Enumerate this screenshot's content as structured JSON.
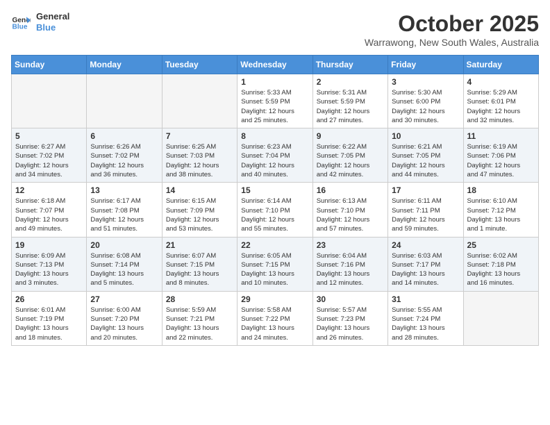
{
  "header": {
    "logo_line1": "General",
    "logo_line2": "Blue",
    "month": "October 2025",
    "location": "Warrawong, New South Wales, Australia"
  },
  "days_of_week": [
    "Sunday",
    "Monday",
    "Tuesday",
    "Wednesday",
    "Thursday",
    "Friday",
    "Saturday"
  ],
  "weeks": [
    [
      {
        "num": "",
        "info": ""
      },
      {
        "num": "",
        "info": ""
      },
      {
        "num": "",
        "info": ""
      },
      {
        "num": "1",
        "info": "Sunrise: 5:33 AM\nSunset: 5:59 PM\nDaylight: 12 hours\nand 25 minutes."
      },
      {
        "num": "2",
        "info": "Sunrise: 5:31 AM\nSunset: 5:59 PM\nDaylight: 12 hours\nand 27 minutes."
      },
      {
        "num": "3",
        "info": "Sunrise: 5:30 AM\nSunset: 6:00 PM\nDaylight: 12 hours\nand 30 minutes."
      },
      {
        "num": "4",
        "info": "Sunrise: 5:29 AM\nSunset: 6:01 PM\nDaylight: 12 hours\nand 32 minutes."
      }
    ],
    [
      {
        "num": "5",
        "info": "Sunrise: 6:27 AM\nSunset: 7:02 PM\nDaylight: 12 hours\nand 34 minutes."
      },
      {
        "num": "6",
        "info": "Sunrise: 6:26 AM\nSunset: 7:02 PM\nDaylight: 12 hours\nand 36 minutes."
      },
      {
        "num": "7",
        "info": "Sunrise: 6:25 AM\nSunset: 7:03 PM\nDaylight: 12 hours\nand 38 minutes."
      },
      {
        "num": "8",
        "info": "Sunrise: 6:23 AM\nSunset: 7:04 PM\nDaylight: 12 hours\nand 40 minutes."
      },
      {
        "num": "9",
        "info": "Sunrise: 6:22 AM\nSunset: 7:05 PM\nDaylight: 12 hours\nand 42 minutes."
      },
      {
        "num": "10",
        "info": "Sunrise: 6:21 AM\nSunset: 7:05 PM\nDaylight: 12 hours\nand 44 minutes."
      },
      {
        "num": "11",
        "info": "Sunrise: 6:19 AM\nSunset: 7:06 PM\nDaylight: 12 hours\nand 47 minutes."
      }
    ],
    [
      {
        "num": "12",
        "info": "Sunrise: 6:18 AM\nSunset: 7:07 PM\nDaylight: 12 hours\nand 49 minutes."
      },
      {
        "num": "13",
        "info": "Sunrise: 6:17 AM\nSunset: 7:08 PM\nDaylight: 12 hours\nand 51 minutes."
      },
      {
        "num": "14",
        "info": "Sunrise: 6:15 AM\nSunset: 7:09 PM\nDaylight: 12 hours\nand 53 minutes."
      },
      {
        "num": "15",
        "info": "Sunrise: 6:14 AM\nSunset: 7:10 PM\nDaylight: 12 hours\nand 55 minutes."
      },
      {
        "num": "16",
        "info": "Sunrise: 6:13 AM\nSunset: 7:10 PM\nDaylight: 12 hours\nand 57 minutes."
      },
      {
        "num": "17",
        "info": "Sunrise: 6:11 AM\nSunset: 7:11 PM\nDaylight: 12 hours\nand 59 minutes."
      },
      {
        "num": "18",
        "info": "Sunrise: 6:10 AM\nSunset: 7:12 PM\nDaylight: 13 hours\nand 1 minute."
      }
    ],
    [
      {
        "num": "19",
        "info": "Sunrise: 6:09 AM\nSunset: 7:13 PM\nDaylight: 13 hours\nand 3 minutes."
      },
      {
        "num": "20",
        "info": "Sunrise: 6:08 AM\nSunset: 7:14 PM\nDaylight: 13 hours\nand 5 minutes."
      },
      {
        "num": "21",
        "info": "Sunrise: 6:07 AM\nSunset: 7:15 PM\nDaylight: 13 hours\nand 8 minutes."
      },
      {
        "num": "22",
        "info": "Sunrise: 6:05 AM\nSunset: 7:15 PM\nDaylight: 13 hours\nand 10 minutes."
      },
      {
        "num": "23",
        "info": "Sunrise: 6:04 AM\nSunset: 7:16 PM\nDaylight: 13 hours\nand 12 minutes."
      },
      {
        "num": "24",
        "info": "Sunrise: 6:03 AM\nSunset: 7:17 PM\nDaylight: 13 hours\nand 14 minutes."
      },
      {
        "num": "25",
        "info": "Sunrise: 6:02 AM\nSunset: 7:18 PM\nDaylight: 13 hours\nand 16 minutes."
      }
    ],
    [
      {
        "num": "26",
        "info": "Sunrise: 6:01 AM\nSunset: 7:19 PM\nDaylight: 13 hours\nand 18 minutes."
      },
      {
        "num": "27",
        "info": "Sunrise: 6:00 AM\nSunset: 7:20 PM\nDaylight: 13 hours\nand 20 minutes."
      },
      {
        "num": "28",
        "info": "Sunrise: 5:59 AM\nSunset: 7:21 PM\nDaylight: 13 hours\nand 22 minutes."
      },
      {
        "num": "29",
        "info": "Sunrise: 5:58 AM\nSunset: 7:22 PM\nDaylight: 13 hours\nand 24 minutes."
      },
      {
        "num": "30",
        "info": "Sunrise: 5:57 AM\nSunset: 7:23 PM\nDaylight: 13 hours\nand 26 minutes."
      },
      {
        "num": "31",
        "info": "Sunrise: 5:55 AM\nSunset: 7:24 PM\nDaylight: 13 hours\nand 28 minutes."
      },
      {
        "num": "",
        "info": ""
      }
    ]
  ]
}
